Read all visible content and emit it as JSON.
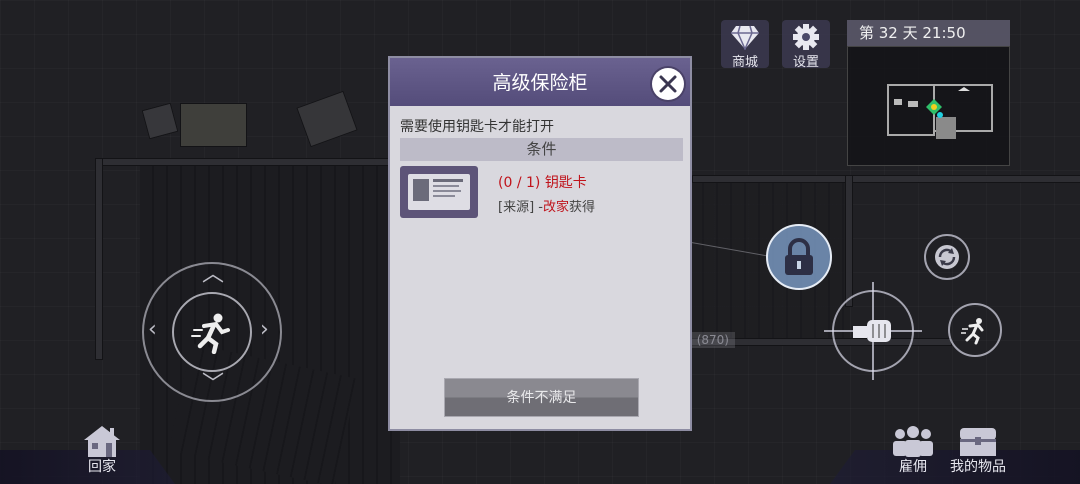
{
  "dialog": {
    "title": "高级保险柜",
    "requirement": "需要使用钥匙卡才能打开",
    "conditions_header": "条件",
    "item": {
      "progress": "(0 / 1)",
      "name": "钥匙卡",
      "source_prefix": "[来源] -",
      "source_place": "改家",
      "source_suffix": "获得"
    },
    "action_button": "条件不满足"
  },
  "top_bar": {
    "shop_label": "商城",
    "settings_label": "设置",
    "day_time": "第 32 天  21:50"
  },
  "scene": {
    "number_label": "(870)"
  },
  "bottom": {
    "home_label": "回家",
    "hire_label": "雇佣",
    "items_label": "我的物品"
  },
  "icons": [
    "diamond-icon",
    "gear-icon",
    "close-icon",
    "padlock-icon",
    "refresh-icon",
    "fist-icon",
    "running-icon",
    "house-icon",
    "people-icon",
    "chest-icon",
    "id-card-icon"
  ]
}
